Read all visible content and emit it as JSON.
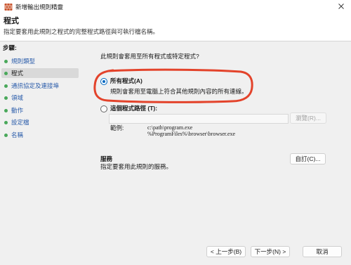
{
  "window": {
    "title": "新增輸出規則精靈",
    "icon": "firewall-icon",
    "close_icon": "close-icon"
  },
  "header": {
    "title": "程式",
    "subtitle": "指定要套用此規則之程式的完整程式路徑與可執行檔名稱。"
  },
  "steps": {
    "heading": "步驟:",
    "items": [
      {
        "label": "規則類型",
        "current": false
      },
      {
        "label": "程式",
        "current": true
      },
      {
        "label": "通訊協定及連接埠",
        "current": false
      },
      {
        "label": "領域",
        "current": false
      },
      {
        "label": "動作",
        "current": false
      },
      {
        "label": "設定檔",
        "current": false
      },
      {
        "label": "名稱",
        "current": false
      }
    ]
  },
  "main": {
    "question": "此規則會套用至所有程式或特定程式?",
    "all_programs": {
      "label": "所有程式(A)",
      "description": "規則會套用至電腦上符合其他規則內容的所有連線。",
      "selected": true
    },
    "program_path": {
      "label": "這個程式路徑 (T):",
      "value": "",
      "selected": false,
      "browse_label": "瀏覽(R)...",
      "browse_disabled": true
    },
    "example": {
      "label": "範例:",
      "line1": "c:\\path\\program.exe",
      "line2": "%ProgramFiles%\\browser\\browser.exe"
    },
    "services": {
      "title": "服務",
      "description": "指定要套用此規則的服務。",
      "button_label": "自訂(C)..."
    }
  },
  "footer": {
    "back_label": "< 上一步(B)",
    "next_label": "下一步(N) >",
    "cancel_label": "取消"
  },
  "colors": {
    "accent": "#0067c0",
    "annotation": "#e3432b",
    "step_bullet": "#49a85a",
    "step_link": "#2a5caa"
  }
}
